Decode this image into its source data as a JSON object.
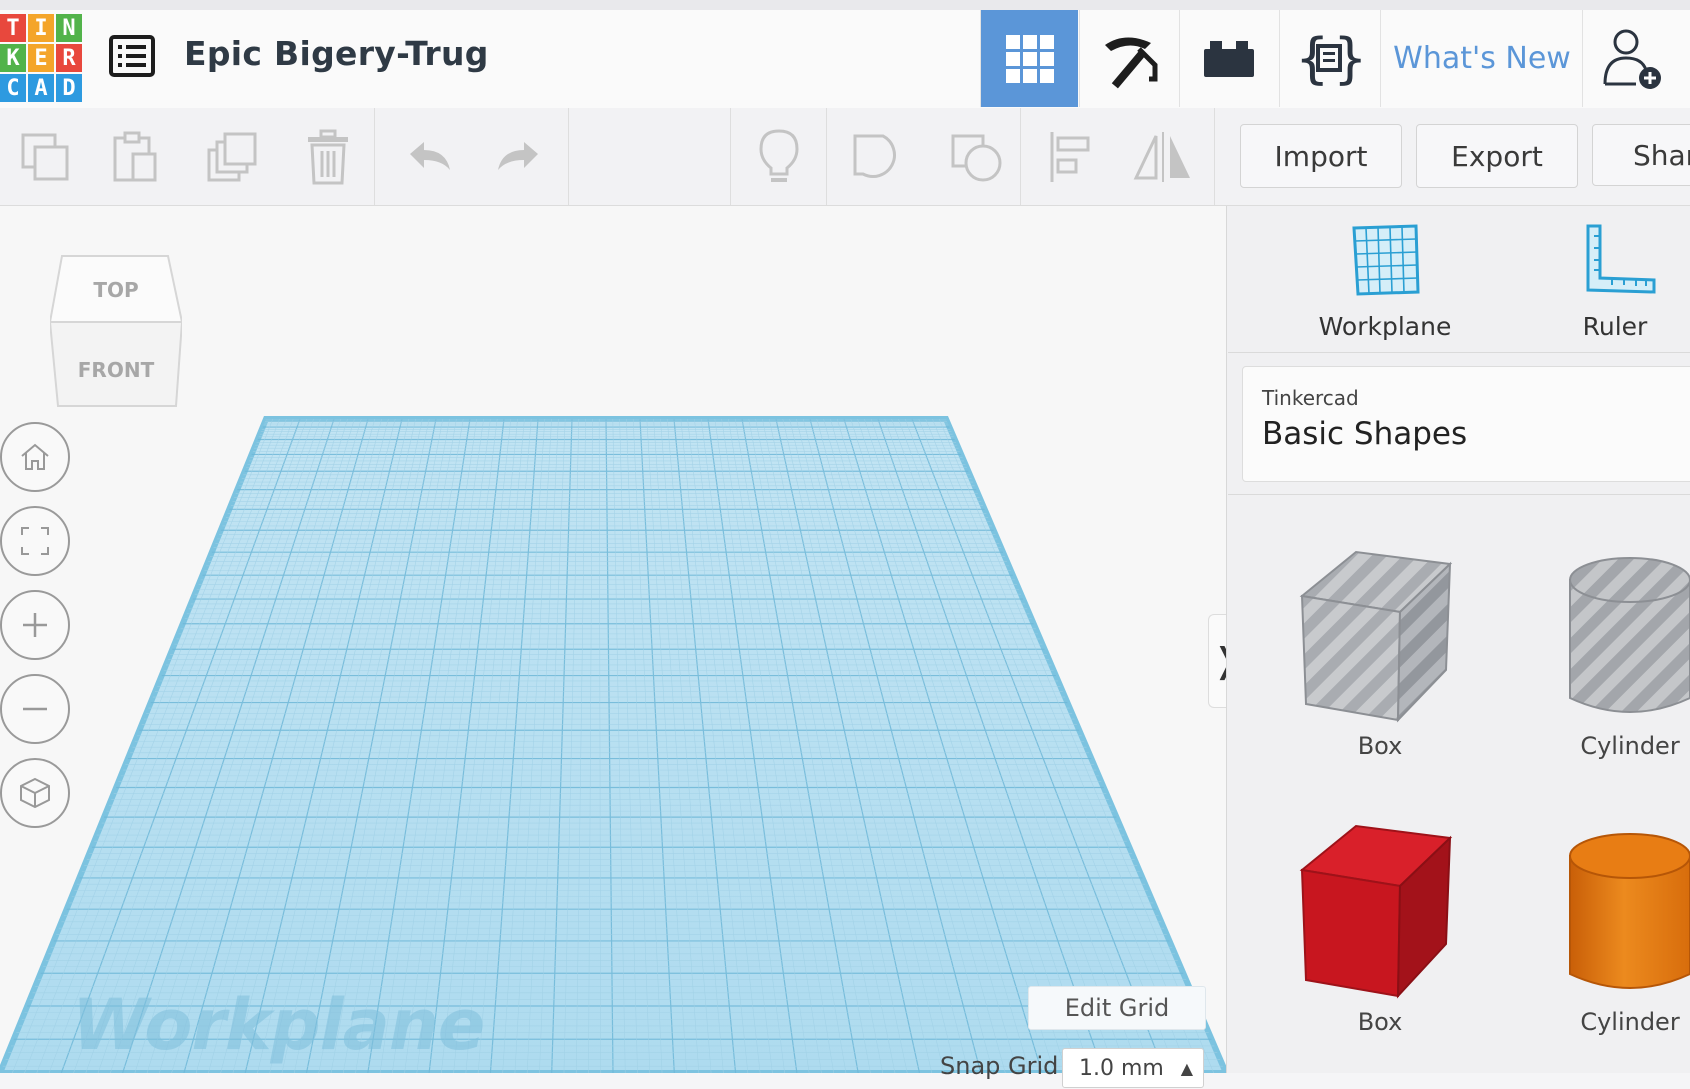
{
  "header": {
    "logo_letters": [
      "T",
      "I",
      "N",
      "K",
      "E",
      "R",
      "C",
      "A",
      "D"
    ],
    "logo_colors": [
      "#e8483d",
      "#f4a52a",
      "#52b34a",
      "#52b34a",
      "#f4a52a",
      "#e8483d",
      "#2d9ae0",
      "#2d9ae0",
      "#2d9ae0"
    ],
    "document_title": "Epic Bigery-Trug",
    "tabs": [
      {
        "name": "3d-design-tab",
        "icon": "grid-icon",
        "active": true
      },
      {
        "name": "codeblocks-tab",
        "icon": "pickaxe-icon",
        "active": false
      },
      {
        "name": "bricks-tab",
        "icon": "brick-icon",
        "active": false
      },
      {
        "name": "code-tab",
        "icon": "curly-braces-icon",
        "active": false
      }
    ],
    "whats_new": "What's New",
    "user_icon": "add-user-icon"
  },
  "toolbar": {
    "import_label": "Import",
    "export_label": "Export",
    "share_label": "Shar"
  },
  "canvas": {
    "viewcube_top": "TOP",
    "viewcube_front": "FRONT",
    "workplane_watermark": "Workplane",
    "edit_grid_label": "Edit Grid",
    "snap_grid_label": "Snap Grid",
    "snap_grid_value": "1.0 mm"
  },
  "panel": {
    "tools": [
      {
        "label": "Workplane",
        "icon": "workplane-icon"
      },
      {
        "label": "Ruler",
        "icon": "ruler-icon"
      }
    ],
    "library_provider": "Tinkercad",
    "library_name": "Basic Shapes",
    "shapes": [
      {
        "label": "Box"
      },
      {
        "label": "Cylinder"
      },
      {
        "label": "Box"
      },
      {
        "label": "Cylinder"
      }
    ]
  },
  "colors": {
    "accent": "#5b96d8",
    "workplane": "#a9dbef",
    "box_red": "#c8161f",
    "cylinder_orange": "#e3730f"
  }
}
